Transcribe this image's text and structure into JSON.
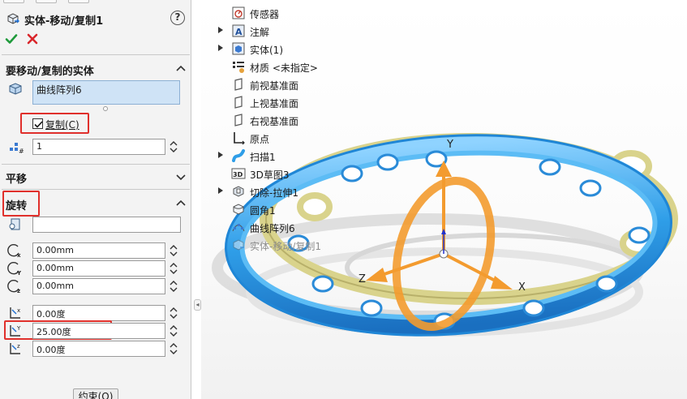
{
  "property_manager": {
    "title": "实体-移动/复制1",
    "help": "?",
    "bodies_group": {
      "header": "要移动/复制的实体",
      "selected": "曲线阵列6",
      "copy_label": "复制(C)",
      "copy_checked": true,
      "copies": "1"
    },
    "translate_group": {
      "header": "平移"
    },
    "rotate_group": {
      "header": "旋转",
      "origin": "",
      "x": "0.00mm",
      "y": "0.00mm",
      "z": "0.00mm",
      "angle_x": "0.00度",
      "angle_y": "25.00度",
      "angle_z": "0.00度"
    },
    "constraints_button": "约束(O)"
  },
  "feature_tree": [
    {
      "label": "传感器",
      "icon": "sensor-icon",
      "expandable": false
    },
    {
      "label": "注解",
      "icon": "annotation-icon",
      "expandable": true
    },
    {
      "label": "实体(1)",
      "icon": "solid-bodies-icon",
      "expandable": true
    },
    {
      "label": "材质 <未指定>",
      "icon": "material-icon",
      "expandable": false
    },
    {
      "label": "前视基准面",
      "icon": "plane-icon",
      "expandable": false
    },
    {
      "label": "上视基准面",
      "icon": "plane-icon",
      "expandable": false
    },
    {
      "label": "右视基准面",
      "icon": "plane-icon",
      "expandable": false
    },
    {
      "label": "原点",
      "icon": "origin-icon",
      "expandable": false
    },
    {
      "label": "扫描1",
      "icon": "sweep-icon",
      "expandable": true
    },
    {
      "label": "3D草图3",
      "icon": "sketch3d-icon",
      "expandable": false
    },
    {
      "label": "切除-拉伸1",
      "icon": "cut-extrude-icon",
      "expandable": true
    },
    {
      "label": "圆角1",
      "icon": "fillet-icon",
      "expandable": false
    },
    {
      "label": "曲线阵列6",
      "icon": "curve-pattern-icon",
      "expandable": false
    },
    {
      "label": "实体-移动/复制1",
      "icon": "move-copy-icon",
      "expandable": false,
      "faded": true
    }
  ],
  "triad": {
    "x": "X",
    "y": "Y",
    "z": "Z"
  },
  "colors": {
    "accent_blue": "#2f9ee8",
    "gold": "#d9d38c",
    "triad_orange": "#f39b2f",
    "highlight_red": "#e0302c",
    "selection_fill": "#cfe3f6"
  }
}
